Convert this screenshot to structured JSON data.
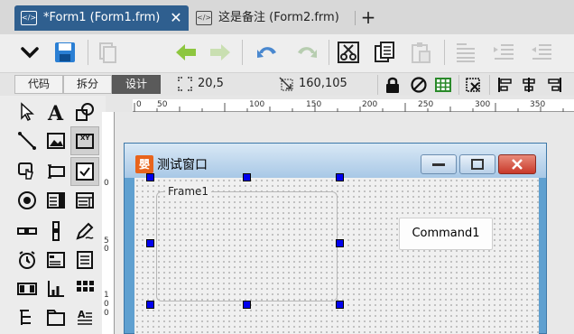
{
  "tabs": [
    {
      "label": "*Form1 (Form1.frm)",
      "icon": "code-file-icon",
      "active": true,
      "close_glyph": "✕"
    },
    {
      "label": "这是备注 (Form2.frm)",
      "icon": "code-file-icon",
      "active": false
    }
  ],
  "new_tab_glyph": "+",
  "toolbar": {
    "buttons": [
      "menu-dropdown-icon",
      "save-icon",
      "copy-file-icon",
      "back-arrow-icon",
      "forward-arrow-icon",
      "undo-icon",
      "redo-icon",
      "cut-icon",
      "copy-icon",
      "paste-icon",
      "align-text-icon",
      "indent-icon",
      "outdent-icon"
    ]
  },
  "modes": {
    "code": "代码",
    "split": "拆分",
    "design": "设计",
    "active": "design"
  },
  "position": {
    "value": "20,5"
  },
  "size": {
    "value": "160,105"
  },
  "ruler": {
    "h_labels": [
      "0",
      "50",
      "100",
      "150",
      "200",
      "250",
      "300",
      "350"
    ],
    "v_labels": [
      [
        "0"
      ],
      [
        "5",
        "0"
      ],
      [
        "1",
        "0",
        "0"
      ]
    ]
  },
  "form": {
    "title": "测试窗口",
    "icon_glyph": "嬰",
    "frame_label": "Frame1",
    "command_label": "Command1"
  },
  "colors": {
    "accent": "#2f5f8f",
    "handle": "#0000ee"
  }
}
